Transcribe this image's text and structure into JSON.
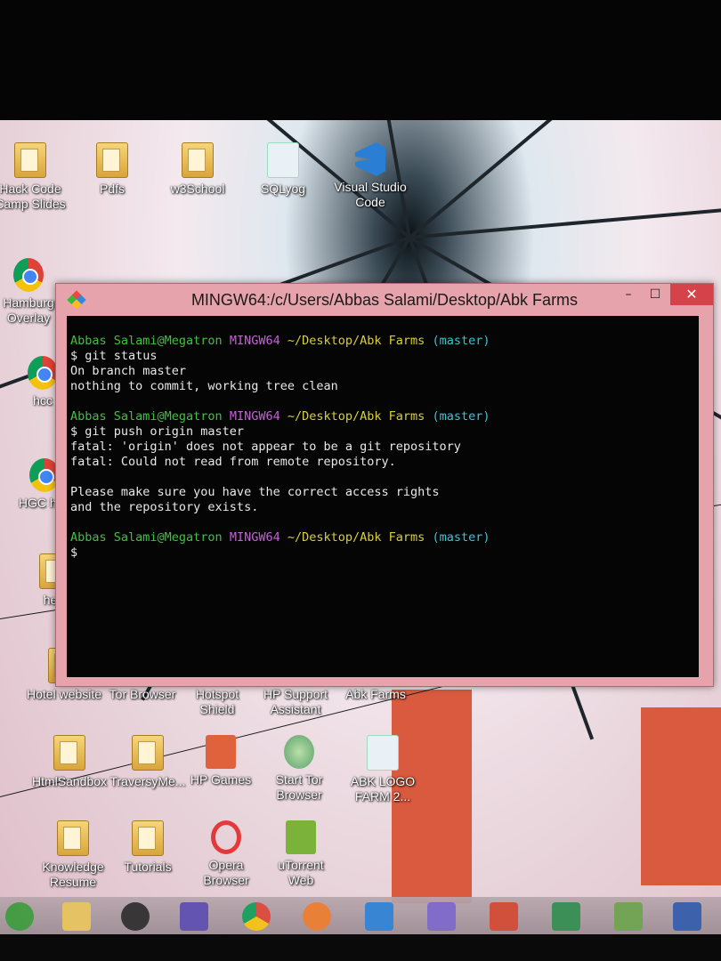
{
  "window": {
    "title": "MINGW64:/c/Users/Abbas Salami/Desktop/Abk Farms",
    "controls": {
      "minimize": "–",
      "maximize": "☐",
      "close": "✕"
    }
  },
  "terminal": {
    "lines": [
      {
        "prompt": {
          "user": "Abbas Salami@Megatron",
          "host": "MINGW64",
          "path": "~/Desktop/Abk Farms",
          "branch": "(master)"
        }
      },
      {
        "text": "$ git status"
      },
      {
        "text": "On branch master"
      },
      {
        "text": "nothing to commit, working tree clean"
      },
      {
        "gap": true
      },
      {
        "prompt": {
          "user": "Abbas Salami@Megatron",
          "host": "MINGW64",
          "path": "~/Desktop/Abk Farms",
          "branch": "(master)"
        }
      },
      {
        "text": "$ git push origin master"
      },
      {
        "text": "fatal: 'origin' does not appear to be a git repository"
      },
      {
        "text": "fatal: Could not read from remote repository."
      },
      {
        "gap": true
      },
      {
        "text": "Please make sure you have the correct access rights"
      },
      {
        "text": "and the repository exists."
      },
      {
        "gap": true
      },
      {
        "prompt": {
          "user": "Abbas Salami@Megatron",
          "host": "MINGW64",
          "path": "~/Desktop/Abk Farms",
          "branch": "(master)"
        }
      },
      {
        "text": "$"
      }
    ]
  },
  "desktop_icons": [
    {
      "label": "Hack Code\nCamp Slides",
      "icon": "folder-icon"
    },
    {
      "label": "Pdfs",
      "icon": "folder-icon"
    },
    {
      "label": "w3School",
      "icon": "folder-icon"
    },
    {
      "label": "SQLyog",
      "icon": "sqlyog-icon"
    },
    {
      "label": "Visual Studio\nCode",
      "icon": "vscode-icon"
    },
    {
      "label": "Hamburg\nOverlay",
      "icon": "chrome-icon"
    },
    {
      "label": "hcc",
      "icon": "chrome-icon"
    },
    {
      "label": "HGC htm",
      "icon": "chrome-icon"
    },
    {
      "label": "help",
      "icon": "folder-icon"
    },
    {
      "label": "Hotel website",
      "icon": "folder-icon"
    },
    {
      "label": "Tor Browser",
      "icon": "folder-icon"
    },
    {
      "label": "Hotspot\nShield",
      "icon": "shortcut-icon"
    },
    {
      "label": "HP Support\nAssistant",
      "icon": "shortcut-icon"
    },
    {
      "label": "Abk Farms",
      "icon": "folder-icon"
    },
    {
      "label": "HtmlSandbox",
      "icon": "folder-icon"
    },
    {
      "label": "TraversyMe...",
      "icon": "folder-icon"
    },
    {
      "label": "HP Games",
      "icon": "hp-games-icon"
    },
    {
      "label": "Start Tor\nBrowser",
      "icon": "tor-icon"
    },
    {
      "label": "ABK LOGO\nFARM 2...",
      "icon": "image-icon"
    },
    {
      "label": "Knowledge\nResume",
      "icon": "folder-icon"
    },
    {
      "label": "Tutorials",
      "icon": "folder-icon"
    },
    {
      "label": "Opera\nBrowser",
      "icon": "opera-icon"
    },
    {
      "label": "uTorrent\nWeb",
      "icon": "utorrent-icon"
    }
  ],
  "colors": {
    "terminal_bg": "#050505",
    "prompt_user": "#3ec23e",
    "prompt_host": "#c660d8",
    "prompt_path": "#d8cf3a",
    "prompt_branch": "#3ac4d6",
    "window_frame": "#e6a3ab",
    "close_button": "#d6424a"
  }
}
